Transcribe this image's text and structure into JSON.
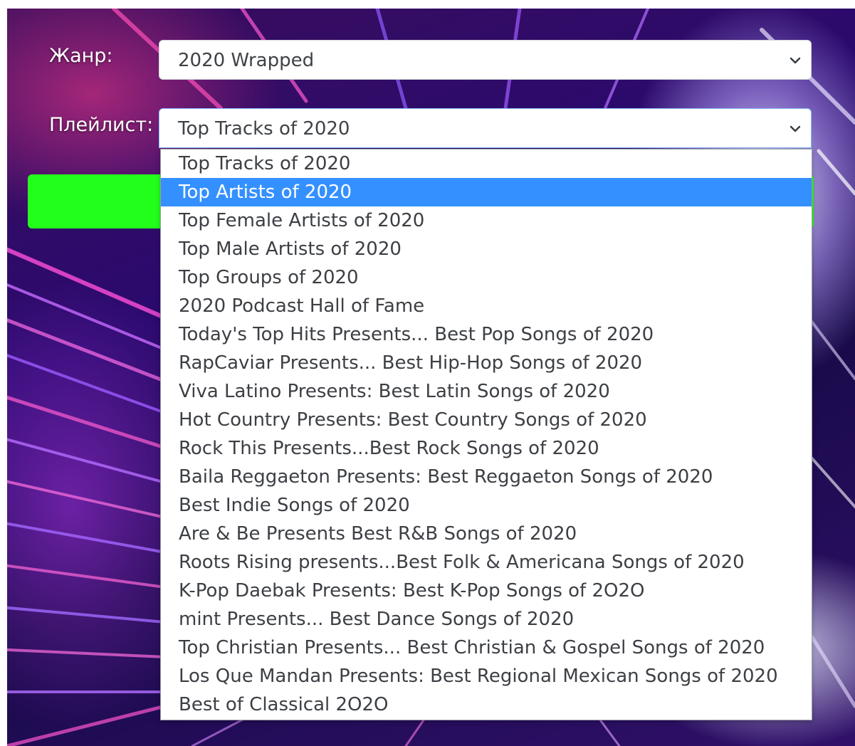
{
  "form": {
    "genre_label": "Жанр:",
    "genre_value": "2020 Wrapped",
    "playlist_label": "Плейлист:",
    "playlist_value": "Top Tracks of 2020"
  },
  "dropdown": {
    "highlighted_index": 1,
    "options": [
      "Top Tracks of 2020",
      "Top Artists of 2020",
      "Top Female Artists of 2020",
      "Top Male Artists of 2020",
      "Top Groups of 2020",
      "2020 Podcast Hall of Fame",
      "Today's Top Hits Presents... Best Pop Songs of 2020",
      "RapCaviar Presents... Best Hip-Hop Songs of 2020",
      "Viva Latino Presents: Best Latin Songs of 2020",
      "Hot Country Presents: Best Country Songs of 2020",
      "Rock This Presents...Best Rock Songs of 2020",
      "Baila Reggaeton Presents: Best Reggaeton Songs of 2020",
      "Best Indie Songs of 2020",
      "Are & Be Presents Best R&B Songs of 2020",
      "Roots Rising presents...Best Folk & Americana Songs of 2020",
      "K-Pop Daebak Presents: Best K-Pop Songs of 2O2O",
      "mint Presents... Best Dance Songs of 2020",
      "Top Christian Presents... Best Christian & Gospel Songs of 2020",
      "Los Que Mandan Presents: Best Regional Mexican Songs of 2020",
      "Best of Classical 2O2O"
    ]
  },
  "colors": {
    "highlight": "#3490ff",
    "submit_button": "#22ff1b"
  },
  "icons": {
    "select_arrow": "chevron-down-icon"
  }
}
